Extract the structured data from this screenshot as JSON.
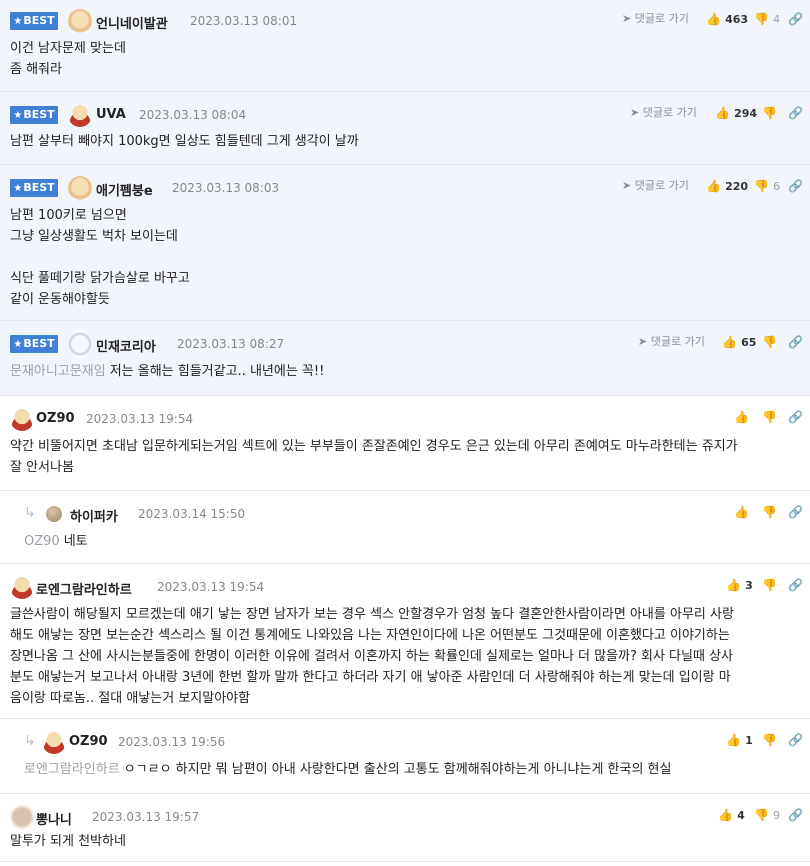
{
  "labels": {
    "best": "BEST",
    "reply_link": "댓글로 가기"
  },
  "comments": [
    {
      "nick": "언니네이발관",
      "date": "2023.03.13 08:01",
      "likes": "463",
      "dislikes": "4",
      "lines": [
        "이건 남자문제 맞는데",
        "좀 해줘라"
      ]
    },
    {
      "nick": "UVA",
      "date": "2023.03.13 08:04",
      "likes": "294",
      "lines": [
        "남편 살부터 빼야지 100kg면 일상도 힘들텐데 그게 생각이 날까"
      ]
    },
    {
      "nick": "애기펨붕e",
      "date": "2023.03.13 08:03",
      "likes": "220",
      "dislikes": "6",
      "lines": [
        "남편 100키로 넘으면",
        "그냥 일상생활도 벅차 보이는데",
        "",
        "식단 풀떼기랑 닭가슴살로 바꾸고",
        "같이 운동해야할듯"
      ]
    },
    {
      "nick": "민재코리아",
      "date": "2023.03.13 08:27",
      "likes": "65",
      "mention": "문재아니고문재임",
      "lines": [
        "저는 올해는 힘들거같고.. 내년에는 꼭!!"
      ]
    },
    {
      "nick": "OZ90",
      "date": "2023.03.13 19:54",
      "lines": [
        "약간 비뚤어지면 초대남 입문하게되는거임 섹트에 있는 부부들이 존잘존예인 경우도 은근 있는데 아무리 존예여도 마누라한테는 쥬지가",
        "잘 안서나봄"
      ]
    },
    {
      "nick": "하이퍼카",
      "date": "2023.03.14 15:50",
      "mention": "OZ90",
      "lines": [
        "네토"
      ]
    },
    {
      "nick": "로엔그람라인하르",
      "date": "2023.03.13 19:54",
      "likes": "3",
      "lines": [
        "글쓴사람이 해당될지 모르겠는데 애기 낳는 장면 남자가 보는 경우 섹스 안할경우가 엄청 높다 결혼안한사람이라면 아내를 아무리 사랑",
        "해도 애낳는 장면 보는순간 섹스리스 될 이건 통계에도 나와있음 나는 자연인이다에 나온 어떤분도 그것때문에 이혼했다고 이야기하는",
        "장면나옴 그 산에 사시는분들중에 한명이 이러한 이유에 걸려서 이혼까지 하는 확률인데 실제로는 얼마나 더 많을까? 회사 다닐때 상사",
        "분도 애낳는거 보고나서 아내랑 3년에 한번 할까 말까 한다고 하더라 자기 애 낳아준 사람인데 더 사랑해줘야 하는게 맞는데 입이랑 마",
        "음이랑 따로놈.. 절대 애낳는거 보지말아야함"
      ]
    },
    {
      "nick": "OZ90",
      "date": "2023.03.13 19:56",
      "likes": "1",
      "mention": "로엔그람라인하르",
      "lines": [
        "ㅇㄱㄹㅇ 하지만 뭐 남편이 아내 사랑한다면 출산의 고통도 함께해줘야하는게 아니냐는게 한국의 현실"
      ]
    },
    {
      "nick": "뽕나니",
      "date": "2023.03.13 19:57",
      "likes": "4",
      "dislikes": "9",
      "lines": [
        "말투가 되게 천박하네"
      ]
    }
  ],
  "icons": [
    "star-icon",
    "reply-arrow-icon",
    "thumbs-up-icon",
    "thumbs-down-icon",
    "link-icon"
  ],
  "colors": {
    "best_badge": "#3f7fd6",
    "best_bg": "#f2f5fb",
    "muted": "#9aa0a8"
  }
}
